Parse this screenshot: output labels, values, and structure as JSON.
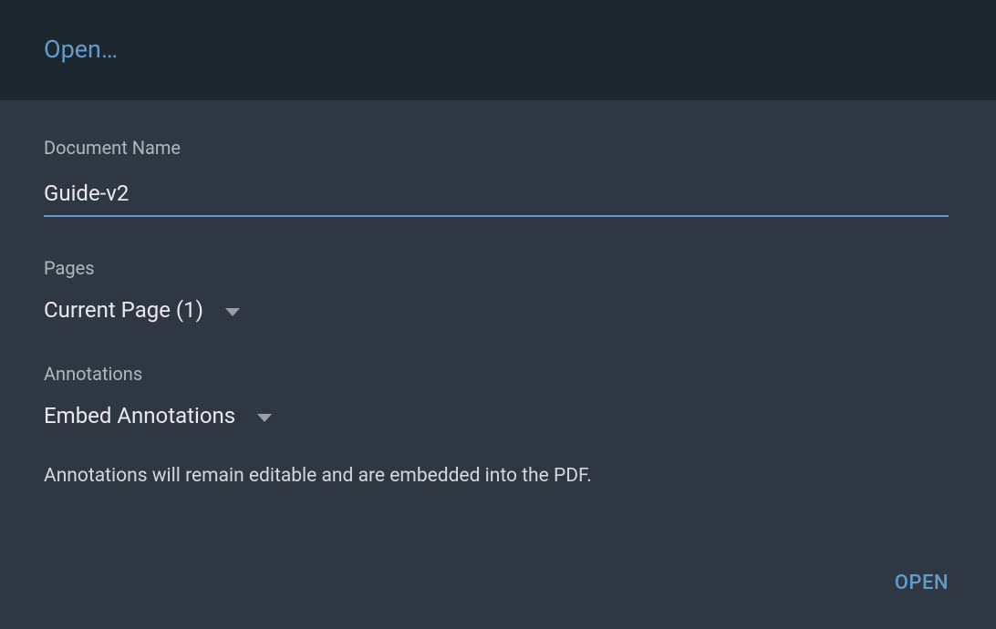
{
  "header": {
    "title": "Open…"
  },
  "form": {
    "document_name": {
      "label": "Document Name",
      "value": "Guide-v2"
    },
    "pages": {
      "label": "Pages",
      "selected": "Current Page (1)"
    },
    "annotations": {
      "label": "Annotations",
      "selected": "Embed Annotations",
      "help_text": "Annotations will remain editable and are embedded into the PDF."
    }
  },
  "footer": {
    "open_button": "OPEN"
  }
}
